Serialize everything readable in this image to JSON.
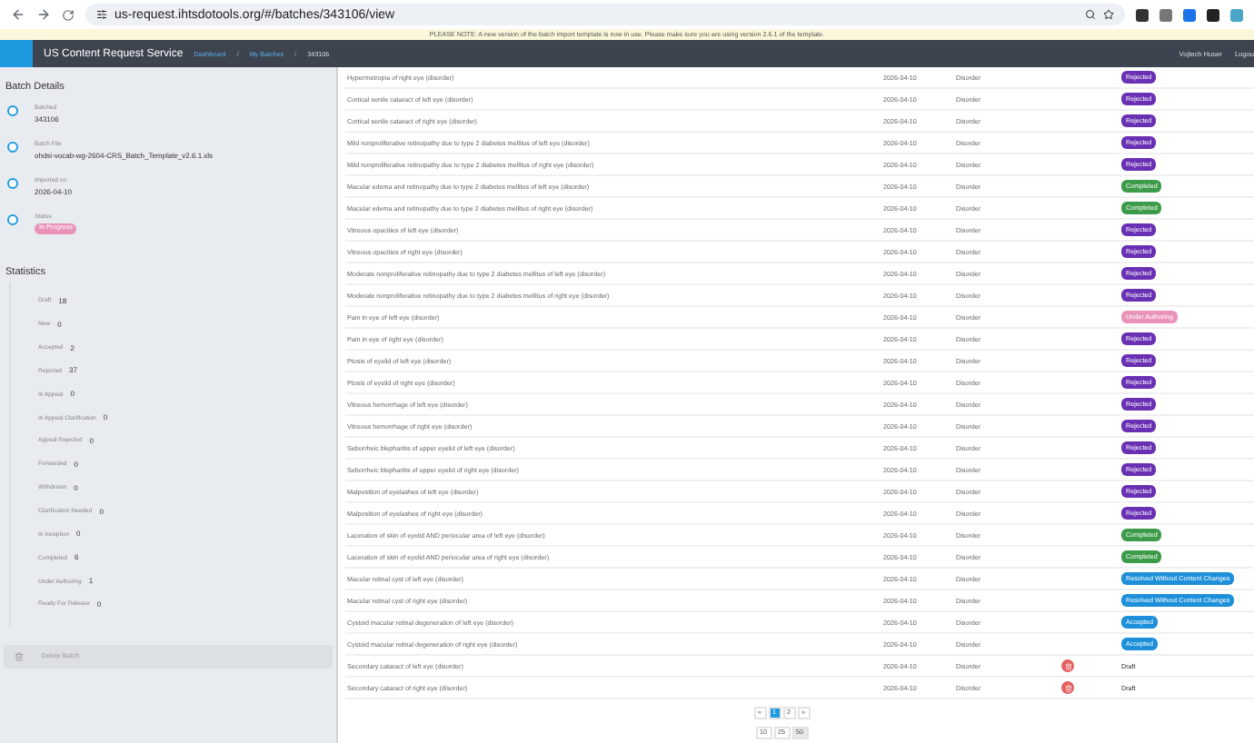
{
  "browser": {
    "url": "us-request.ihtsdotools.org/#/batches/343106/view"
  },
  "notice": "PLEASE NOTE: A new version of the batch import template is now in use. Please make sure you are using version 2.6.1 of the template.",
  "header": {
    "title": "US Content Request Service",
    "breadcrumbs": [
      "Dashboard",
      "My Batches",
      "343106"
    ],
    "separator": "/",
    "user": "Vojtech Huser",
    "logout": "Logou"
  },
  "batch_details": {
    "title": "Batch Details",
    "items": [
      {
        "label": "Batched",
        "value": "343106",
        "kind": "text"
      },
      {
        "label": "Batch File",
        "value": "ohdsi-vocab-wg-2604-CRS_Batch_Template_v2.6.1.xls",
        "kind": "text"
      },
      {
        "label": "Imported on",
        "value": "2026-04-10",
        "kind": "text"
      },
      {
        "label": "Status",
        "value": "In Progress",
        "kind": "badge"
      }
    ]
  },
  "statistics": {
    "title": "Statistics",
    "items": [
      {
        "label": "Draft",
        "value": "18"
      },
      {
        "label": "New",
        "value": "0"
      },
      {
        "label": "Accepted",
        "value": "2"
      },
      {
        "label": "Rejected",
        "value": "37"
      },
      {
        "label": "In Appeal",
        "value": "0"
      },
      {
        "label": "In Appeal Clarification",
        "value": "0"
      },
      {
        "label": "Appeal Rejected",
        "value": "0"
      },
      {
        "label": "Forwarded",
        "value": "0"
      },
      {
        "label": "Withdrawn",
        "value": "0"
      },
      {
        "label": "Clarification Needed",
        "value": "0"
      },
      {
        "label": "In Inception",
        "value": "0"
      },
      {
        "label": "Completed",
        "value": "6"
      },
      {
        "label": "Under Authoring",
        "value": "1"
      },
      {
        "label": "Ready For Release",
        "value": "0"
      }
    ]
  },
  "delete_button": "Delete Batch",
  "rows": [
    {
      "name": "Hypermetropia of right eye (disorder)",
      "date": "2026-04-10",
      "type": "Disorder",
      "deletable": false,
      "status": {
        "label": "Rejected",
        "kind": "rejected"
      }
    },
    {
      "name": "Cortical senile cataract of left eye (disorder)",
      "date": "2026-04-10",
      "type": "Disorder",
      "deletable": false,
      "status": {
        "label": "Rejected",
        "kind": "rejected"
      }
    },
    {
      "name": "Cortical senile cataract of right eye (disorder)",
      "date": "2026-04-10",
      "type": "Disorder",
      "deletable": false,
      "status": {
        "label": "Rejected",
        "kind": "rejected"
      }
    },
    {
      "name": "Mild nonproliferative retinopathy due to type 2 diabetes mellitus of left eye (disorder)",
      "date": "2026-04-10",
      "type": "Disorder",
      "deletable": false,
      "status": {
        "label": "Rejected",
        "kind": "rejected"
      }
    },
    {
      "name": "Mild nonproliferative retinopathy due to type 2 diabetes mellitus of right eye (disorder)",
      "date": "2026-04-10",
      "type": "Disorder",
      "deletable": false,
      "status": {
        "label": "Rejected",
        "kind": "rejected"
      }
    },
    {
      "name": "Macular edema and retinopathy due to type 2 diabetes mellitus of left eye (disorder)",
      "date": "2026-04-10",
      "type": "Disorder",
      "deletable": false,
      "status": {
        "label": "Completed",
        "kind": "completed"
      }
    },
    {
      "name": "Macular edema and retinopathy due to type 2 diabetes mellitus of right eye (disorder)",
      "date": "2026-04-10",
      "type": "Disorder",
      "deletable": false,
      "status": {
        "label": "Completed",
        "kind": "completed"
      }
    },
    {
      "name": "Vitreous opacities of left eye (disorder)",
      "date": "2026-04-10",
      "type": "Disorder",
      "deletable": false,
      "status": {
        "label": "Rejected",
        "kind": "rejected"
      }
    },
    {
      "name": "Vitreous opacities of right eye (disorder)",
      "date": "2026-04-10",
      "type": "Disorder",
      "deletable": false,
      "status": {
        "label": "Rejected",
        "kind": "rejected"
      }
    },
    {
      "name": "Moderate nonproliferative retinopathy due to type 2 diabetes mellitus of left eye (disorder)",
      "date": "2026-04-10",
      "type": "Disorder",
      "deletable": false,
      "status": {
        "label": "Rejected",
        "kind": "rejected"
      }
    },
    {
      "name": "Moderate nonproliferative retinopathy due to type 2 diabetes mellitus of right eye (disorder)",
      "date": "2026-04-10",
      "type": "Disorder",
      "deletable": false,
      "status": {
        "label": "Rejected",
        "kind": "rejected"
      }
    },
    {
      "name": "Pain in eye of left eye (disorder)",
      "date": "2026-04-10",
      "type": "Disorder",
      "deletable": false,
      "status": {
        "label": "Under Authoring",
        "kind": "authoring"
      }
    },
    {
      "name": "Pain in eye of right eye (disorder)",
      "date": "2026-04-10",
      "type": "Disorder",
      "deletable": false,
      "status": {
        "label": "Rejected",
        "kind": "rejected"
      }
    },
    {
      "name": "Ptosis of eyelid of left eye (disorder)",
      "date": "2026-04-10",
      "type": "Disorder",
      "deletable": false,
      "status": {
        "label": "Rejected",
        "kind": "rejected"
      }
    },
    {
      "name": "Ptosis of eyelid of right eye (disorder)",
      "date": "2026-04-10",
      "type": "Disorder",
      "deletable": false,
      "status": {
        "label": "Rejected",
        "kind": "rejected"
      }
    },
    {
      "name": "Vitreous hemorrhage of left eye (disorder)",
      "date": "2026-04-10",
      "type": "Disorder",
      "deletable": false,
      "status": {
        "label": "Rejected",
        "kind": "rejected"
      }
    },
    {
      "name": "Vitreous hemorrhage of right eye (disorder)",
      "date": "2026-04-10",
      "type": "Disorder",
      "deletable": false,
      "status": {
        "label": "Rejected",
        "kind": "rejected"
      }
    },
    {
      "name": "Seborrheic blepharitis of upper eyelid of left eye (disorder)",
      "date": "2026-04-10",
      "type": "Disorder",
      "deletable": false,
      "status": {
        "label": "Rejected",
        "kind": "rejected"
      }
    },
    {
      "name": "Seborrheic blepharitis of upper eyelid of right eye (disorder)",
      "date": "2026-04-10",
      "type": "Disorder",
      "deletable": false,
      "status": {
        "label": "Rejected",
        "kind": "rejected"
      }
    },
    {
      "name": "Malposition of eyelashes of left eye (disorder)",
      "date": "2026-04-10",
      "type": "Disorder",
      "deletable": false,
      "status": {
        "label": "Rejected",
        "kind": "rejected"
      }
    },
    {
      "name": "Malposition of eyelashes of right eye (disorder)",
      "date": "2026-04-10",
      "type": "Disorder",
      "deletable": false,
      "status": {
        "label": "Rejected",
        "kind": "rejected"
      }
    },
    {
      "name": "Laceration of skin of eyelid AND periocular area of left eye (disorder)",
      "date": "2026-04-10",
      "type": "Disorder",
      "deletable": false,
      "status": {
        "label": "Completed",
        "kind": "completed"
      }
    },
    {
      "name": "Laceration of skin of eyelid AND periocular area of right eye (disorder)",
      "date": "2026-04-10",
      "type": "Disorder",
      "deletable": false,
      "status": {
        "label": "Completed",
        "kind": "completed"
      }
    },
    {
      "name": "Macular retinal cyst of left eye (disorder)",
      "date": "2026-04-10",
      "type": "Disorder",
      "deletable": false,
      "status": {
        "label": "Resolved Without Content Changes",
        "kind": "resolved"
      }
    },
    {
      "name": "Macular retinal cyst of right eye (disorder)",
      "date": "2026-04-10",
      "type": "Disorder",
      "deletable": false,
      "status": {
        "label": "Resolved Without Content Changes",
        "kind": "resolved"
      }
    },
    {
      "name": "Cystoid macular retinal degeneration of left eye (disorder)",
      "date": "2026-04-10",
      "type": "Disorder",
      "deletable": false,
      "status": {
        "label": "Accepted",
        "kind": "accepted"
      }
    },
    {
      "name": "Cystoid macular retinal degeneration of right eye (disorder)",
      "date": "2026-04-10",
      "type": "Disorder",
      "deletable": false,
      "status": {
        "label": "Accepted",
        "kind": "accepted"
      }
    },
    {
      "name": "Secondary cataract of left eye (disorder)",
      "date": "2026-04-10",
      "type": "Disorder",
      "deletable": true,
      "status": {
        "label": "Draft",
        "kind": "draft"
      }
    },
    {
      "name": "Secondary cataract of right eye (disorder)",
      "date": "2026-04-10",
      "type": "Disorder",
      "deletable": true,
      "status": {
        "label": "Draft",
        "kind": "draft"
      }
    }
  ],
  "pagination": {
    "prev": "«",
    "pages": [
      {
        "label": "1",
        "selected": true
      },
      {
        "label": "2",
        "selected": false
      }
    ],
    "next": "»",
    "sizes": [
      {
        "label": "10",
        "selected": false
      },
      {
        "label": "25",
        "selected": false
      },
      {
        "label": "50",
        "selected": true
      }
    ]
  }
}
